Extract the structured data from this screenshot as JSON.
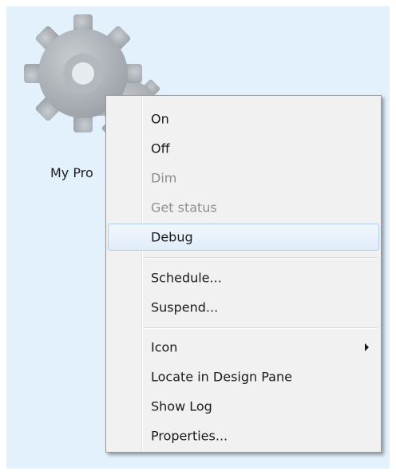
{
  "desktop": {
    "item_label": "My Pro"
  },
  "context_menu": {
    "items": [
      {
        "label": "On",
        "enabled": true
      },
      {
        "label": "Off",
        "enabled": true
      },
      {
        "label": "Dim",
        "enabled": false
      },
      {
        "label": "Get status",
        "enabled": false
      },
      {
        "label": "Debug",
        "enabled": true,
        "highlighted": true
      },
      {
        "label": "Schedule...",
        "enabled": true
      },
      {
        "label": "Suspend...",
        "enabled": true
      },
      {
        "label": "Icon",
        "enabled": true,
        "submenu": true
      },
      {
        "label": "Locate in Design Pane",
        "enabled": true
      },
      {
        "label": "Show Log",
        "enabled": true
      },
      {
        "label": "Properties...",
        "enabled": true
      }
    ]
  },
  "colors": {
    "desktop_background": "#e3f1fc",
    "menu_background": "#f1f1f1",
    "highlight_border": "#aeccf0",
    "disabled_text": "#8d8d8d"
  }
}
